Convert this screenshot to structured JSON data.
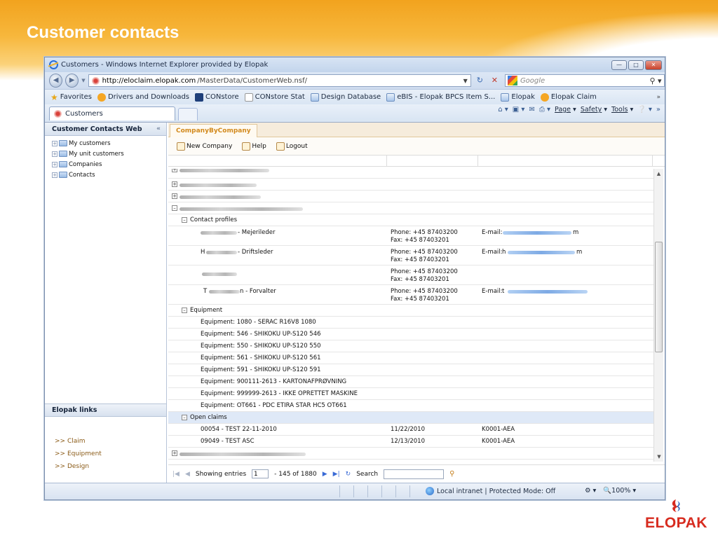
{
  "slide": {
    "title": "Customer contacts"
  },
  "browser": {
    "window_title": "Customers - Windows Internet Explorer provided by Elopak",
    "url_domain": "http://eloclaim.elopak.com",
    "url_path": "/MasterData/CustomerWeb.nsf/",
    "search_placeholder": "Google",
    "favorites": {
      "label": "Favorites",
      "items": [
        "Drivers and Downloads",
        "CONstore",
        "CONstore Stat",
        "Design Database",
        "eBIS - Elopak BPCS Item S...",
        "Elopak",
        "Elopak Claim"
      ]
    },
    "tab_label": "Customers",
    "command_bar": {
      "page": "Page",
      "safety": "Safety",
      "tools": "Tools"
    },
    "status": {
      "zone": "Local intranet | Protected Mode: Off",
      "zoom": "100%"
    }
  },
  "sidebar": {
    "title": "Customer Contacts Web",
    "tree": [
      "My customers",
      "My unit customers",
      "Companies",
      "Contacts"
    ],
    "links_title": "Elopak links",
    "links": [
      ">> Claim",
      ">> Equipment",
      ">> Design"
    ]
  },
  "main": {
    "tab": "CompanyByCompany",
    "toolbar": {
      "new_company": "New Company",
      "help": "Help",
      "logout": "Logout"
    },
    "contact_profiles_label": "Contact profiles",
    "contacts": [
      {
        "name_suffix": "- Mejerileder",
        "phone": "Phone: +45 87403200",
        "fax": "Fax: +45 87403201",
        "email_label": "E-mail:",
        "email_suffix": "m"
      },
      {
        "name_prefix": "H",
        "name_suffix": "- Driftsleder",
        "phone": "Phone: +45 87403200",
        "fax": "Fax: +45 87403201",
        "email_label": "E-mail:",
        "email_prefix": "h",
        "email_suffix": "m"
      },
      {
        "name_suffix": "",
        "phone": "Phone: +45 87403200",
        "fax": "Fax: +45 87403201",
        "email_label": "",
        "email_suffix": ""
      },
      {
        "name_prefix": "T",
        "name_suffix": "n - Forvalter",
        "phone": "Phone: +45 87403200",
        "fax": "Fax: +45 87403201",
        "email_label": "E-mail:",
        "email_prefix": "t",
        "email_suffix": ""
      }
    ],
    "equipment_label": "Equipment",
    "equipment": [
      "Equipment: 1080 - SERAC R16V8 1080",
      "Equipment: 546 - SHIKOKU UP-S120 546",
      "Equipment: 550 - SHIKOKU UP-S120 550",
      "Equipment: 561 - SHIKOKU UP-S120 561",
      "Equipment: 591 - SHIKOKU UP-S120 591",
      "Equipment: 900111-2613 - KARTONAFPRØVNING",
      "Equipment: 999999-2613 - IKKE OPRETTET MASKINE",
      "Equipment: OT661 - PDC ETIRA STAR HC5 OT661"
    ],
    "open_claims_label": "Open claims",
    "claims": [
      {
        "id": "00054 - TEST 22-11-2010",
        "date": "11/22/2010",
        "code": "K0001-AEA"
      },
      {
        "id": "09049 - TEST ASC",
        "date": "12/13/2010",
        "code": "K0001-AEA"
      }
    ],
    "pager": {
      "showing": "Showing entries",
      "page": "1",
      "range": "- 145 of 1880",
      "search": "Search"
    }
  },
  "logo": {
    "text": "ELOPAK"
  }
}
